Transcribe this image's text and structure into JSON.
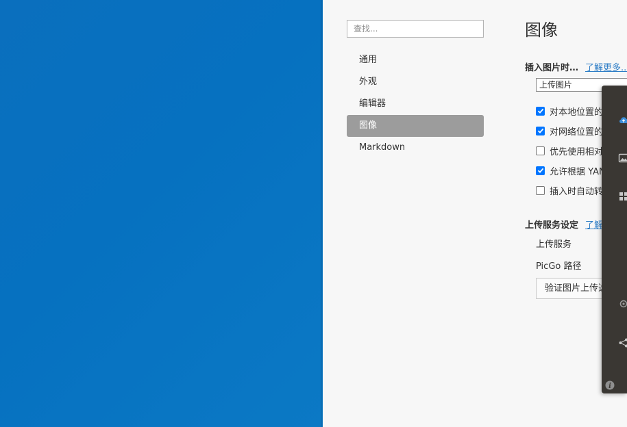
{
  "search": {
    "placeholder": "查找..."
  },
  "nav": {
    "items": [
      {
        "label": "通用",
        "active": false
      },
      {
        "label": "外观",
        "active": false
      },
      {
        "label": "编辑器",
        "active": false
      },
      {
        "label": "图像",
        "active": true
      },
      {
        "label": "Markdown",
        "active": false
      }
    ]
  },
  "content": {
    "title": "图像",
    "insert_section": {
      "title": "插入图片时…",
      "link": "了解更多..."
    },
    "insert_action": {
      "selected": "上传图片"
    },
    "options": [
      {
        "label": "对本地位置的",
        "checked": true
      },
      {
        "label": "对网络位置的",
        "checked": true
      },
      {
        "label": "优先使用相对",
        "checked": false
      },
      {
        "label": "允许根据 YAM",
        "checked": true
      },
      {
        "label": "插入时自动转",
        "checked": false
      }
    ],
    "upload_section": {
      "title": "上传服务设定",
      "link": "了解"
    },
    "upload_service_label": "上传服务",
    "picgo_path_label": "PicGo 路径",
    "verify_button": "验证图片上传选"
  },
  "side_panel": {
    "icons": [
      "cloud-upload-icon",
      "image-icon",
      "grid-icon",
      "settings-icon",
      "share-icon",
      "info-icon"
    ],
    "accent": "#3b8fdb"
  },
  "colors": {
    "desktop": "#0671c0",
    "active_nav": "#9c9c9c",
    "link": "#2d7dc6",
    "checkbox": "#0075ff",
    "side_panel": "#3a3733"
  }
}
